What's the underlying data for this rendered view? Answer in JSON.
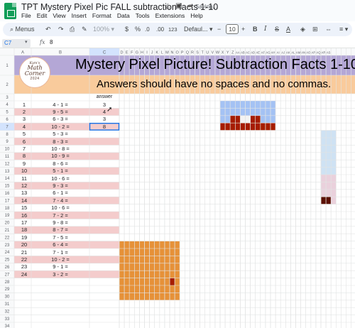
{
  "window": {
    "title": "TPT Mystery Pixel Pic FALL subtraction facts 1-10",
    "status": "Saving..."
  },
  "menu": [
    "File",
    "Edit",
    "View",
    "Insert",
    "Format",
    "Data",
    "Tools",
    "Extensions",
    "Help"
  ],
  "toolbar": {
    "menus_label": "Menus",
    "zoom": "100%",
    "currency": "$",
    "percent": "%",
    "decimal_decrease": ".0",
    "decimal_increase": ".00",
    "more_formats": "123",
    "font": "Defaul...",
    "font_size": "10",
    "bold": "B",
    "italic": "I",
    "strikethrough": "S",
    "text_color": "A"
  },
  "formula_bar": {
    "cell_ref": "C7",
    "fx": "fx",
    "value": "8"
  },
  "sheet": {
    "columns": [
      "A",
      "B",
      "C",
      "D",
      "E",
      "F",
      "G",
      "H",
      "I",
      "J",
      "K",
      "L",
      "M",
      "N",
      "O",
      "P",
      "Q",
      "R",
      "S",
      "T",
      "U",
      "V",
      "W",
      "X",
      "Y",
      "Z",
      "AA",
      "AB",
      "AC",
      "AD",
      "AE",
      "AF",
      "AG",
      "AH",
      "AI",
      "AJ",
      "AK",
      "AL",
      "AM",
      "AN",
      "AO",
      "AP",
      "AQ",
      "AR",
      "AS"
    ],
    "row_count": 34,
    "selected_cell": "C7",
    "banner_title": "Mystery Pixel Picture! Subtraction Facts 1-10",
    "banner_subtitle": "Answers should have no spaces and no commas.",
    "answer_header": "answer",
    "logo": {
      "line1": "Kym's",
      "line2": "Math",
      "line3": "Corner",
      "line4": "2024"
    },
    "problems": [
      {
        "n": "1",
        "q": "4 - 1 =",
        "a": "3"
      },
      {
        "n": "2",
        "q": "9 - 5 =",
        "a": "4"
      },
      {
        "n": "3",
        "q": "6 - 3 =",
        "a": "3"
      },
      {
        "n": "4",
        "q": "10 - 2 =",
        "a": "8"
      },
      {
        "n": "5",
        "q": "5 - 3 =",
        "a": ""
      },
      {
        "n": "6",
        "q": "8 - 3 =",
        "a": ""
      },
      {
        "n": "7",
        "q": "10 - 8 =",
        "a": ""
      },
      {
        "n": "8",
        "q": "10 - 9 =",
        "a": ""
      },
      {
        "n": "9",
        "q": "8 - 6 =",
        "a": ""
      },
      {
        "n": "10",
        "q": "5 - 1 =",
        "a": ""
      },
      {
        "n": "11",
        "q": "10 - 6 =",
        "a": ""
      },
      {
        "n": "12",
        "q": "9 - 3 =",
        "a": ""
      },
      {
        "n": "13",
        "q": "6 - 1 =",
        "a": ""
      },
      {
        "n": "14",
        "q": "7 - 4 =",
        "a": ""
      },
      {
        "n": "15",
        "q": "10 - 6 =",
        "a": ""
      },
      {
        "n": "16",
        "q": "7 - 2 =",
        "a": ""
      },
      {
        "n": "17",
        "q": "9 - 8 =",
        "a": ""
      },
      {
        "n": "18",
        "q": "8 - 7 =",
        "a": ""
      },
      {
        "n": "19",
        "q": "7 - 5 =",
        "a": ""
      },
      {
        "n": "20",
        "q": "6 - 4 =",
        "a": ""
      },
      {
        "n": "21",
        "q": "7 - 1 =",
        "a": ""
      },
      {
        "n": "22",
        "q": "10 - 2 =",
        "a": ""
      },
      {
        "n": "23",
        "q": "9 - 1 =",
        "a": ""
      },
      {
        "n": "24",
        "q": "3 - 2 =",
        "a": ""
      }
    ]
  },
  "colors": {
    "banner_purple": "#b4a7d6",
    "banner_peach": "#f9cb9c",
    "row_pink": "#f4cccc",
    "pixel_blue": "#a4c2f4",
    "pixel_red": "#a61c00",
    "pixel_white": "#f3f3f3",
    "pixel_orange": "#e69138",
    "pixel_light_blue": "#cfe2f3",
    "pixel_rose": "#ead1dc",
    "pixel_dark_red": "#5b0f00",
    "selection": "#1a73e8"
  }
}
